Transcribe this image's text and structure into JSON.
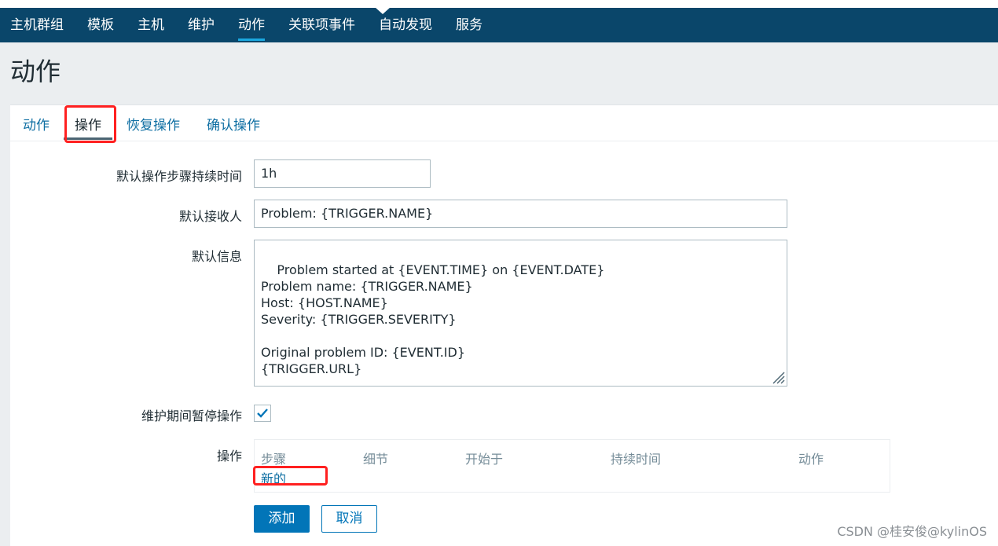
{
  "nav": {
    "items": [
      {
        "label": "主机群组"
      },
      {
        "label": "模板"
      },
      {
        "label": "主机"
      },
      {
        "label": "维护"
      },
      {
        "label": "动作",
        "active": true
      },
      {
        "label": "关联项事件"
      },
      {
        "label": "自动发现"
      },
      {
        "label": "服务"
      }
    ]
  },
  "page": {
    "title": "动作"
  },
  "tabs": {
    "items": [
      {
        "label": "动作"
      },
      {
        "label": "操作",
        "active": true
      },
      {
        "label": "恢复操作"
      },
      {
        "label": "确认操作"
      }
    ]
  },
  "form": {
    "step_duration_label": "默认操作步骤持续时间",
    "step_duration_value": "1h",
    "subject_label": "默认接收人",
    "subject_value": "Problem: {TRIGGER.NAME}",
    "message_label": "默认信息",
    "message_value": "Problem started at {EVENT.TIME} on {EVENT.DATE}\nProblem name: {TRIGGER.NAME}\nHost: {HOST.NAME}\nSeverity: {TRIGGER.SEVERITY}\n\nOriginal problem ID: {EVENT.ID}\n{TRIGGER.URL}",
    "pause_label": "维护期间暂停操作",
    "pause_checked": true,
    "operations_label": "操作"
  },
  "operations_table": {
    "headers": [
      "步骤",
      "细节",
      "开始于",
      "持续时间",
      "动作"
    ],
    "new_link": "新的"
  },
  "buttons": {
    "add": "添加",
    "cancel": "取消"
  },
  "watermark": "CSDN @桂安俊@kylinOS",
  "colors": {
    "navbar": "#0a466a",
    "link": "#0f6fa3",
    "primary_button": "#0275b8",
    "highlight": "#ff2020"
  }
}
